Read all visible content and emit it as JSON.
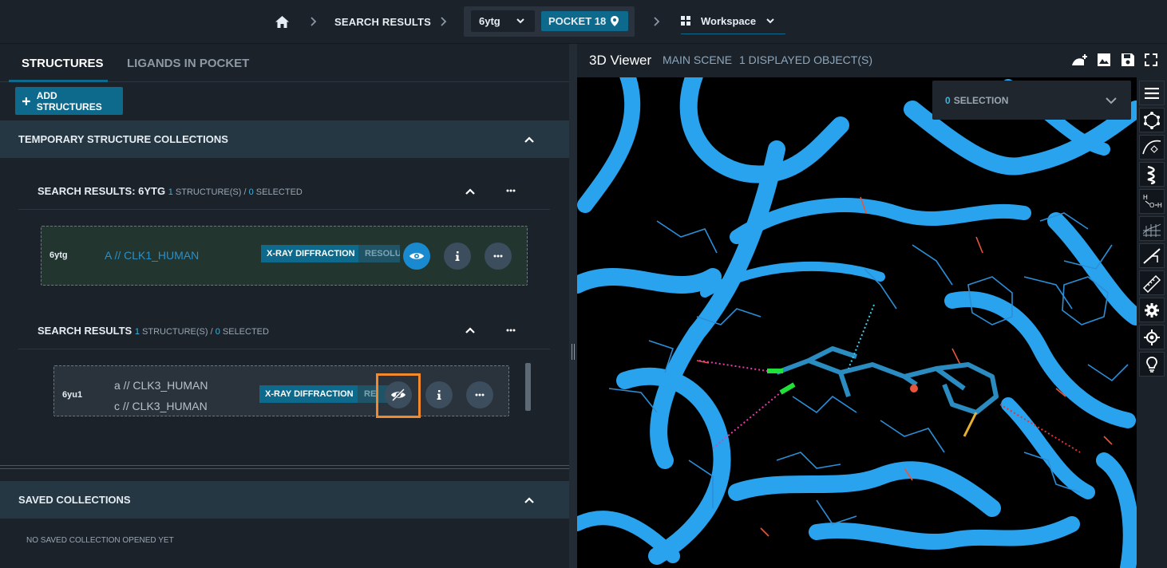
{
  "breadcrumb": {
    "search_results": "SEARCH RESULTS",
    "pdb": "6ytg",
    "pocket": "POCKET 18",
    "workspace": "Workspace"
  },
  "tabs": {
    "structures": "STRUCTURES",
    "ligands": "LIGANDS IN POCKET"
  },
  "add_structures": "ADD STRUCTURES",
  "temporary": {
    "title": "TEMPORARY STRUCTURE COLLECTIONS",
    "groups": [
      {
        "title": "SEARCH RESULTS: 6YTG",
        "count": "1",
        "count_label": "STRUCTURE(S) /",
        "selected": "0",
        "selected_label": "SELECTED",
        "entry": {
          "id": "6ytg",
          "chains": [
            "A // CLK1_HUMAN"
          ],
          "method": "X-RAY DIFFRACTION",
          "resolution": "RESOLUTION"
        }
      },
      {
        "title": "SEARCH RESULTS",
        "count": "1",
        "count_label": "STRUCTURE(S) /",
        "selected": "0",
        "selected_label": "SELECTED",
        "entry": {
          "id": "6yu1",
          "chains": [
            "a // CLK3_HUMAN",
            "c // CLK3_HUMAN"
          ],
          "method": "X-RAY DIFFRACTION",
          "resolution": "RE"
        }
      }
    ]
  },
  "saved": {
    "title": "SAVED COLLECTIONS",
    "empty": "NO SAVED COLLECTION OPENED YET"
  },
  "viewer": {
    "title": "3D Viewer",
    "scene": "MAIN SCENE",
    "objects": "1 DISPLAYED OBJECT(S)",
    "selection_count": "0",
    "selection_label": "SELECTION"
  },
  "colors": {
    "accent": "#0d6a8c",
    "ribbon": "#2aa3ee",
    "highlight": "#f08a2c",
    "hbond": "#e83bb0"
  }
}
